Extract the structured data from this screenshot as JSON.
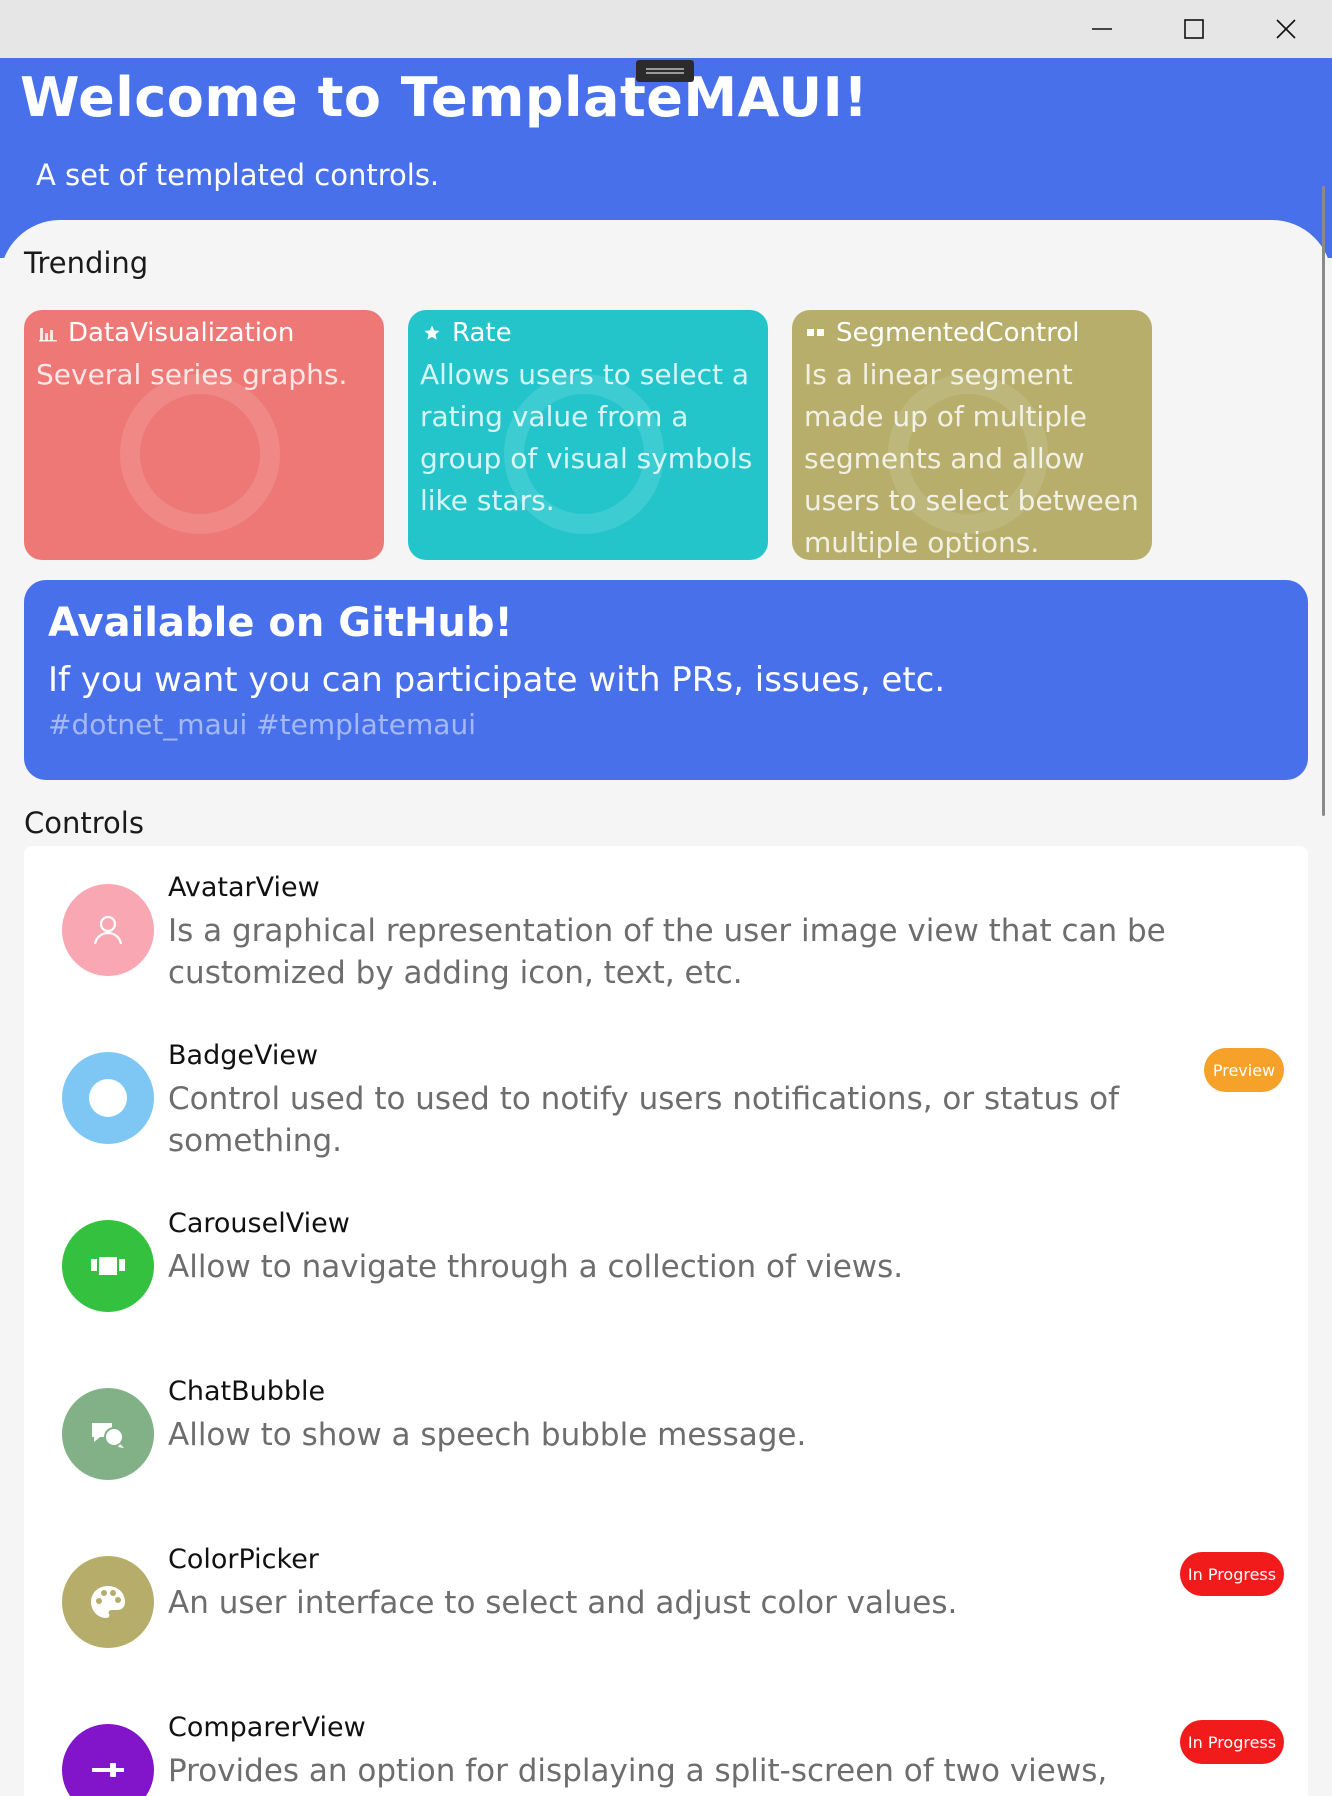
{
  "window": {
    "minimize_icon": "minimize-icon",
    "maximize_icon": "maximize-icon",
    "close_icon": "close-icon"
  },
  "header": {
    "title": "Welcome to TemplateMAUI!",
    "subtitle": "A set of templated controls.",
    "color": "#4770ea"
  },
  "trending": {
    "title": "Trending",
    "cards": [
      {
        "label": "DataVisualization",
        "icon": "bar-chart-icon",
        "description": "Several series graphs.",
        "color": "#ee7876"
      },
      {
        "label": "Rate",
        "icon": "star-icon",
        "description": "Allows users to select a rating value from a group of visual symbols like stars.",
        "color": "#23c5cb"
      },
      {
        "label": "SegmentedControl",
        "icon": "segments-icon",
        "description": "Is a linear segment made up of multiple segments and allow users to select between multiple options.",
        "color": "#b6ae6a"
      }
    ]
  },
  "github": {
    "title": "Available on GitHub!",
    "description": "If you want you can participate with PRs, issues, etc.",
    "tags": "#dotnet_maui #templatemaui"
  },
  "controls": {
    "title": "Controls",
    "items": [
      {
        "name": "AvatarView",
        "description": "Is a graphical representation of the user image view that can be customized by adding icon, text, etc.",
        "icon": "user-icon",
        "color": "#f9a7b2",
        "badge": ""
      },
      {
        "name": "BadgeView",
        "description": "Control used to  used to notify users notifications, or status of something.",
        "icon": "dot-icon",
        "color": "#7ec7f4",
        "badge": "Preview",
        "badge_color": "#f5a12a"
      },
      {
        "name": "CarouselView",
        "description": "Allow to navigate through a collection of views.",
        "icon": "carousel-icon",
        "color": "#33c13f",
        "badge": ""
      },
      {
        "name": "ChatBubble",
        "description": "Allow to show a speech bubble message.",
        "icon": "chat-icon",
        "color": "#82b187",
        "badge": ""
      },
      {
        "name": "ColorPicker",
        "description": "An user interface to select and adjust color values.",
        "icon": "palette-icon",
        "color": "#b5ad69",
        "badge": "In Progress",
        "badge_color": "#f21b1b"
      },
      {
        "name": "ComparerView",
        "description": "Provides an option for displaying a split-screen of two views, which can",
        "icon": "slider-icon",
        "color": "#8214c9",
        "badge": "In Progress",
        "badge_color": "#f21b1b"
      }
    ]
  }
}
